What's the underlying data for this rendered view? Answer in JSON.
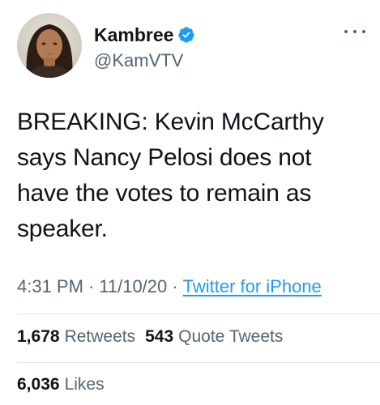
{
  "author": {
    "display_name": "Kambree",
    "handle": "@KamVTV",
    "verified": true,
    "avatar_icon": "profile-photo"
  },
  "menu_icon": "more-dots-icon",
  "tweet": {
    "lines": [
      "BREAKING: Kevin McCarthy",
      "says Nancy Pelosi does not",
      "have the votes to remain as",
      "speaker."
    ]
  },
  "meta": {
    "time": "4:31 PM",
    "separator": "·",
    "date": "11/10/20",
    "source": "Twitter for iPhone"
  },
  "stats": {
    "retweets_count": "1,678",
    "retweets_label": "Retweets",
    "quotes_count": "543",
    "quotes_label": "Quote Tweets",
    "likes_count": "6,036",
    "likes_label": "Likes"
  },
  "colors": {
    "primary_text": "#0f1419",
    "secondary_text": "#536471",
    "link": "#1d9bf0",
    "verified_badge": "#1d9bf0",
    "divider": "#dfe3e6"
  }
}
